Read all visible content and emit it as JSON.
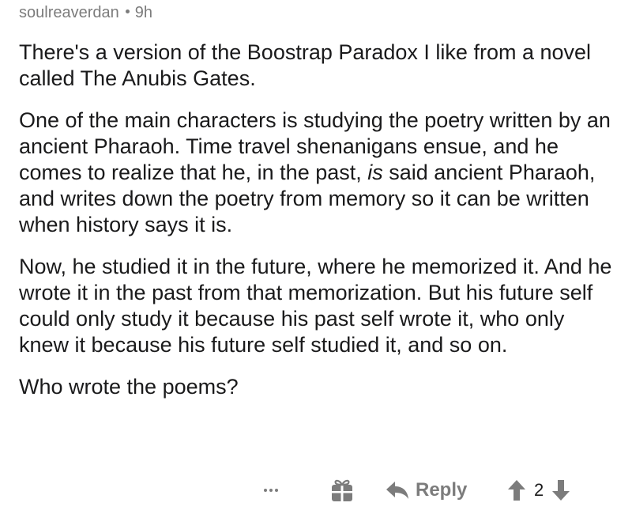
{
  "comment": {
    "username": "soulreaverdan",
    "age": "9h",
    "paragraphs": [
      {
        "parts": [
          {
            "text": "There's a version of the Boostrap Paradox I like from a novel called The Anubis Gates.",
            "italic": false
          }
        ]
      },
      {
        "parts": [
          {
            "text": "One of the main characters is studying the poetry written by an ancient Pharaoh. Time travel shenanigans ensue, and he comes to realize that he, in the past, ",
            "italic": false
          },
          {
            "text": "is",
            "italic": true
          },
          {
            "text": " said ancient Pharaoh, and writes down the poetry from memory so it can be written when history says it is.",
            "italic": false
          }
        ]
      },
      {
        "parts": [
          {
            "text": "Now, he studied it in the future, where he memorized it. And he wrote it in the past from that memorization. But his future self could only study it because his past self wrote it, who only knew it because his future self studied it, and so on.",
            "italic": false
          }
        ]
      },
      {
        "parts": [
          {
            "text": "Who wrote the poems?",
            "italic": false
          }
        ]
      }
    ]
  },
  "actions": {
    "more_icon": "more-dots-icon",
    "gift_icon": "gift-icon",
    "reply_icon": "reply-arrow-icon",
    "reply_label": "Reply",
    "upvote_icon": "upvote-arrow-icon",
    "score": "2",
    "downvote_icon": "downvote-arrow-icon"
  },
  "colors": {
    "meta": "#7c7c7c",
    "text": "#1a1a1b",
    "icons": "#7c7c7c"
  }
}
